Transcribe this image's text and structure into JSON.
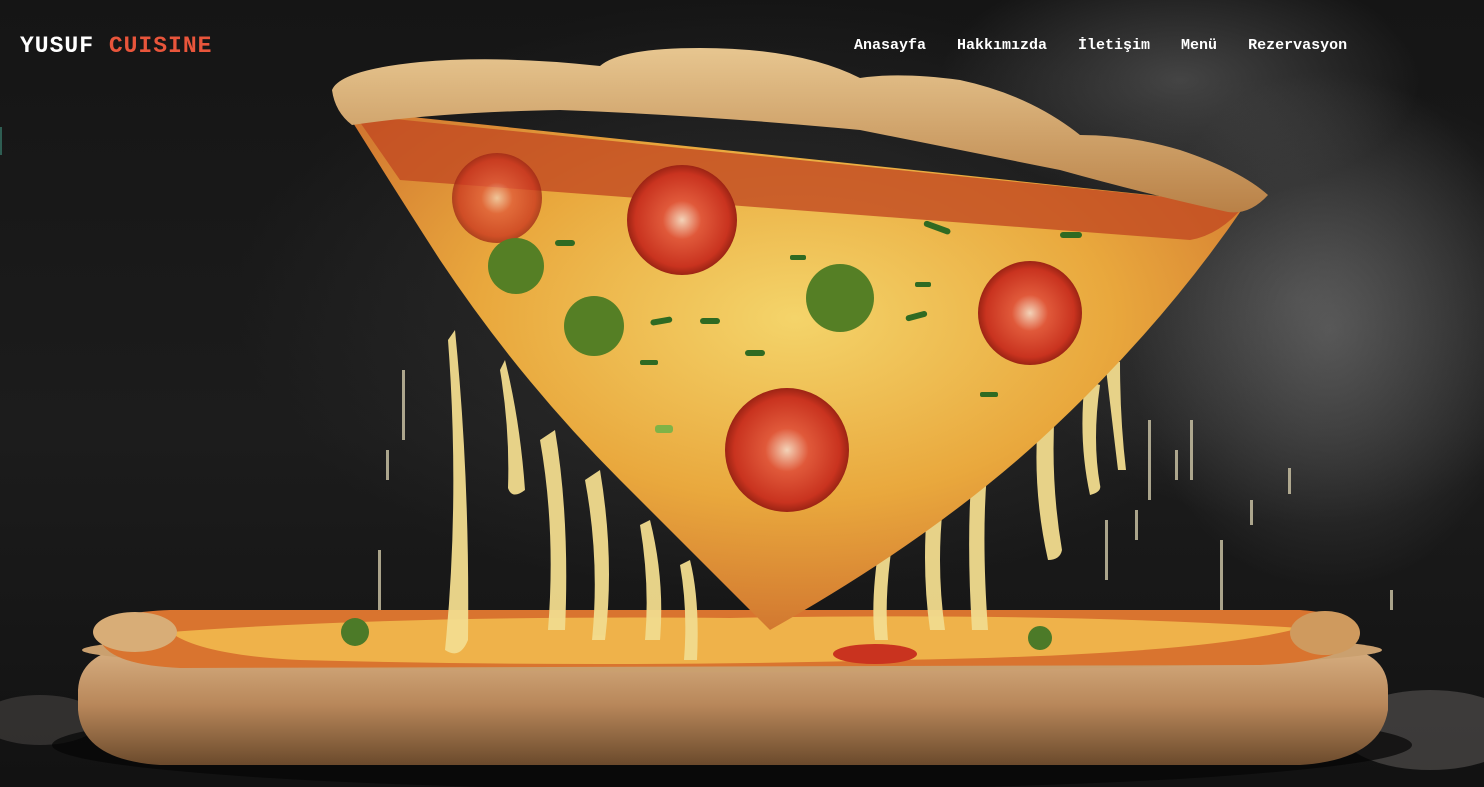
{
  "brand": {
    "first": "YUSUF",
    "second": "CUISINE",
    "accent_color": "#e8553b"
  },
  "nav": [
    {
      "label": "Anasayfa"
    },
    {
      "label": "Hakkımızda"
    },
    {
      "label": "İletişim"
    },
    {
      "label": "Menü"
    },
    {
      "label": "Rezervasyon"
    }
  ],
  "hero": {
    "image": "pizza-slice-with-melting-cheese"
  }
}
